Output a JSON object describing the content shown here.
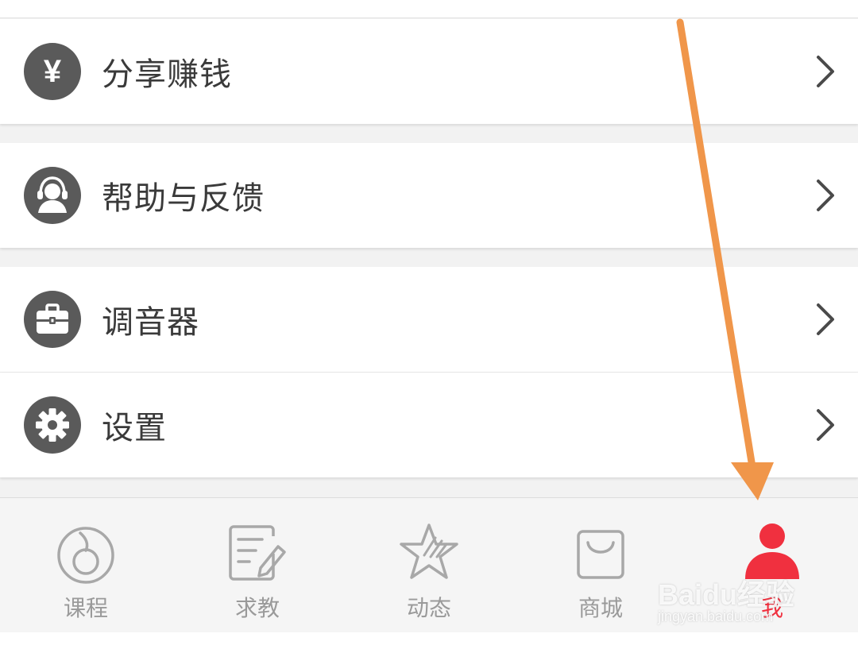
{
  "menu": {
    "items": [
      {
        "label": "分享赚钱",
        "icon": "yen-icon"
      },
      {
        "label": "帮助与反馈",
        "icon": "headset-support-icon"
      },
      {
        "label": "调音器",
        "icon": "toolbox-icon"
      },
      {
        "label": "设置",
        "icon": "gear-icon"
      }
    ],
    "chevron_icon": "chevron-right-icon",
    "yen_symbol": "¥"
  },
  "tabbar": {
    "tabs": [
      {
        "label": "课程",
        "icon": "music-disc-icon"
      },
      {
        "label": "求教",
        "icon": "edit-note-icon"
      },
      {
        "label": "动态",
        "icon": "star-guitar-icon"
      },
      {
        "label": "商城",
        "icon": "shopping-bag-icon"
      },
      {
        "label": "我",
        "icon": "user-icon"
      }
    ],
    "active_index": 4,
    "active_color": "#f0303f",
    "inactive_color": "#9a9a9a"
  },
  "annotation": {
    "arrow_color": "#f0964a"
  },
  "watermark": {
    "brand": "Baidu经验",
    "url": "jingyan.baidu.com"
  }
}
